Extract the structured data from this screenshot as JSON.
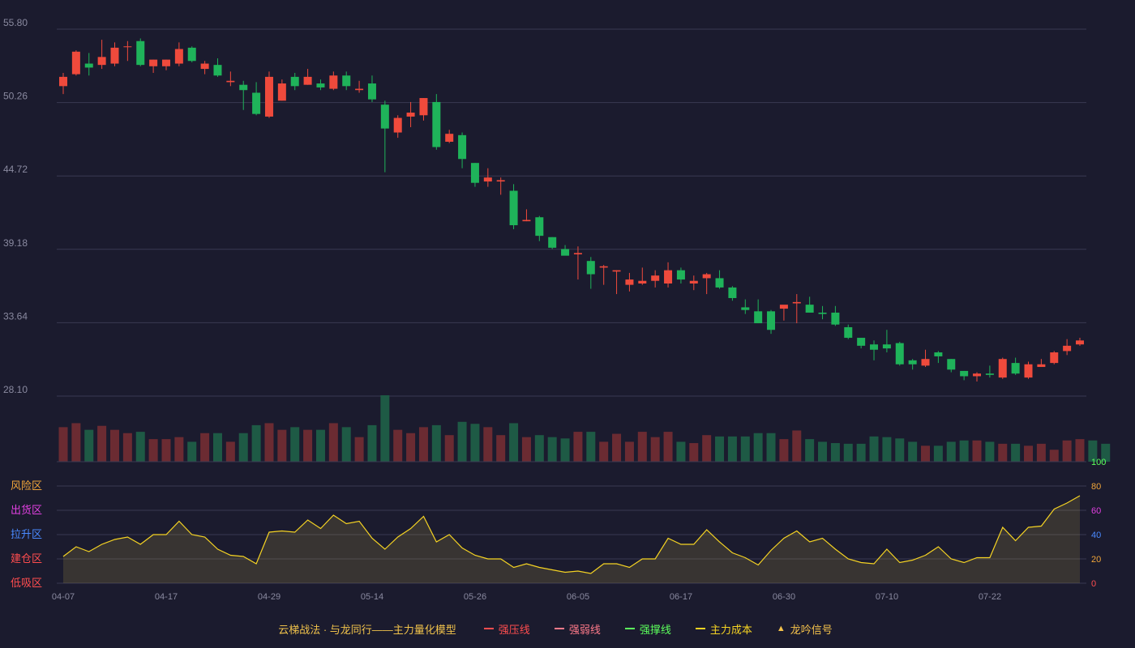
{
  "chart_data": {
    "type": "candlestick",
    "x_ticks": [
      "04-07",
      "04-17",
      "04-29",
      "05-14",
      "05-26",
      "06-05",
      "06-17",
      "06-30",
      "07-10",
      "07-22"
    ],
    "price_axis": {
      "ticks": [
        "55.80",
        "50.26",
        "44.72",
        "39.18",
        "33.64",
        "28.10"
      ],
      "ylim": [
        28.1,
        55.8
      ]
    },
    "candles": [
      {
        "o": 51.5,
        "h": 52.5,
        "l": 50.9,
        "c": 52.2
      },
      {
        "o": 52.4,
        "h": 54.2,
        "l": 52.3,
        "c": 54.1
      },
      {
        "o": 53.2,
        "h": 54.0,
        "l": 52.3,
        "c": 52.9
      },
      {
        "o": 53.1,
        "h": 55.0,
        "l": 52.8,
        "c": 53.7
      },
      {
        "o": 53.2,
        "h": 54.8,
        "l": 53.0,
        "c": 54.4
      },
      {
        "o": 54.5,
        "h": 54.9,
        "l": 53.4,
        "c": 54.5
      },
      {
        "o": 54.9,
        "h": 55.1,
        "l": 53.0,
        "c": 53.1
      },
      {
        "o": 53.0,
        "h": 53.5,
        "l": 52.5,
        "c": 53.5
      },
      {
        "o": 53.0,
        "h": 53.5,
        "l": 52.7,
        "c": 53.5
      },
      {
        "o": 53.2,
        "h": 54.8,
        "l": 53.0,
        "c": 54.3
      },
      {
        "o": 54.4,
        "h": 54.5,
        "l": 53.3,
        "c": 53.4
      },
      {
        "o": 52.8,
        "h": 53.4,
        "l": 52.4,
        "c": 53.2
      },
      {
        "o": 53.1,
        "h": 53.6,
        "l": 52.2,
        "c": 52.3
      },
      {
        "o": 51.8,
        "h": 52.6,
        "l": 51.5,
        "c": 51.9
      },
      {
        "o": 51.6,
        "h": 51.9,
        "l": 49.7,
        "c": 51.2
      },
      {
        "o": 51.0,
        "h": 51.8,
        "l": 49.3,
        "c": 49.4
      },
      {
        "o": 49.2,
        "h": 52.6,
        "l": 49.1,
        "c": 52.2
      },
      {
        "o": 50.4,
        "h": 52.0,
        "l": 50.4,
        "c": 51.7
      },
      {
        "o": 52.2,
        "h": 52.5,
        "l": 51.2,
        "c": 51.5
      },
      {
        "o": 51.6,
        "h": 52.8,
        "l": 51.6,
        "c": 52.2
      },
      {
        "o": 51.7,
        "h": 52.0,
        "l": 51.2,
        "c": 51.4
      },
      {
        "o": 51.3,
        "h": 52.6,
        "l": 51.2,
        "c": 52.3
      },
      {
        "o": 52.3,
        "h": 52.6,
        "l": 51.2,
        "c": 51.5
      },
      {
        "o": 51.2,
        "h": 51.9,
        "l": 51.0,
        "c": 51.3
      },
      {
        "o": 51.7,
        "h": 52.3,
        "l": 50.3,
        "c": 50.5
      },
      {
        "o": 50.1,
        "h": 50.4,
        "l": 45.0,
        "c": 48.3
      },
      {
        "o": 48.0,
        "h": 49.3,
        "l": 47.6,
        "c": 49.1
      },
      {
        "o": 49.2,
        "h": 50.3,
        "l": 48.4,
        "c": 49.5
      },
      {
        "o": 49.3,
        "h": 50.6,
        "l": 48.9,
        "c": 50.6
      },
      {
        "o": 50.3,
        "h": 50.9,
        "l": 46.7,
        "c": 46.9
      },
      {
        "o": 47.3,
        "h": 48.2,
        "l": 47.2,
        "c": 47.9
      },
      {
        "o": 47.8,
        "h": 48.0,
        "l": 45.3,
        "c": 46.0
      },
      {
        "o": 45.7,
        "h": 45.7,
        "l": 43.9,
        "c": 44.2
      },
      {
        "o": 44.3,
        "h": 45.3,
        "l": 43.9,
        "c": 44.6
      },
      {
        "o": 44.3,
        "h": 44.6,
        "l": 43.3,
        "c": 44.4
      },
      {
        "o": 43.6,
        "h": 44.1,
        "l": 40.7,
        "c": 41.0
      },
      {
        "o": 41.3,
        "h": 42.2,
        "l": 41.3,
        "c": 41.4
      },
      {
        "o": 41.6,
        "h": 41.7,
        "l": 39.8,
        "c": 40.2
      },
      {
        "o": 40.1,
        "h": 40.1,
        "l": 39.2,
        "c": 39.3
      },
      {
        "o": 39.2,
        "h": 39.5,
        "l": 38.8,
        "c": 38.7
      },
      {
        "o": 38.8,
        "h": 39.4,
        "l": 36.9,
        "c": 38.9
      },
      {
        "o": 38.3,
        "h": 38.6,
        "l": 36.2,
        "c": 37.3
      },
      {
        "o": 37.8,
        "h": 38.0,
        "l": 36.5,
        "c": 37.9
      },
      {
        "o": 37.5,
        "h": 37.6,
        "l": 35.8,
        "c": 37.6
      },
      {
        "o": 36.5,
        "h": 37.4,
        "l": 36.0,
        "c": 36.9
      },
      {
        "o": 36.6,
        "h": 37.8,
        "l": 36.5,
        "c": 36.8
      },
      {
        "o": 36.8,
        "h": 37.6,
        "l": 36.3,
        "c": 37.2
      },
      {
        "o": 36.6,
        "h": 38.2,
        "l": 36.3,
        "c": 37.6
      },
      {
        "o": 37.6,
        "h": 37.8,
        "l": 36.6,
        "c": 36.9
      },
      {
        "o": 36.6,
        "h": 37.2,
        "l": 36.1,
        "c": 36.8
      },
      {
        "o": 37.0,
        "h": 37.4,
        "l": 35.8,
        "c": 37.3
      },
      {
        "o": 37.0,
        "h": 37.6,
        "l": 36.2,
        "c": 36.3
      },
      {
        "o": 36.3,
        "h": 36.4,
        "l": 35.3,
        "c": 35.5
      },
      {
        "o": 34.8,
        "h": 35.4,
        "l": 34.3,
        "c": 34.6
      },
      {
        "o": 34.5,
        "h": 35.4,
        "l": 33.6,
        "c": 33.6
      },
      {
        "o": 34.5,
        "h": 34.6,
        "l": 32.8,
        "c": 33.1
      },
      {
        "o": 34.7,
        "h": 34.8,
        "l": 33.8,
        "c": 35.0
      },
      {
        "o": 35.1,
        "h": 35.8,
        "l": 33.6,
        "c": 35.2
      },
      {
        "o": 35.0,
        "h": 35.6,
        "l": 34.4,
        "c": 34.4
      },
      {
        "o": 34.4,
        "h": 34.9,
        "l": 33.9,
        "c": 34.3
      },
      {
        "o": 34.4,
        "h": 34.9,
        "l": 33.4,
        "c": 33.5
      },
      {
        "o": 33.3,
        "h": 33.5,
        "l": 32.4,
        "c": 32.5
      },
      {
        "o": 32.5,
        "h": 32.5,
        "l": 31.7,
        "c": 31.9
      },
      {
        "o": 32.0,
        "h": 32.3,
        "l": 30.8,
        "c": 31.6
      },
      {
        "o": 32.0,
        "h": 33.1,
        "l": 31.4,
        "c": 31.7
      },
      {
        "o": 32.1,
        "h": 32.2,
        "l": 30.4,
        "c": 30.5
      },
      {
        "o": 30.8,
        "h": 30.9,
        "l": 30.1,
        "c": 30.5
      },
      {
        "o": 30.4,
        "h": 31.6,
        "l": 30.3,
        "c": 30.9
      },
      {
        "o": 31.4,
        "h": 31.5,
        "l": 30.6,
        "c": 31.1
      },
      {
        "o": 30.9,
        "h": 30.9,
        "l": 29.9,
        "c": 30.1
      },
      {
        "o": 30.0,
        "h": 30.0,
        "l": 29.3,
        "c": 29.6
      },
      {
        "o": 29.6,
        "h": 29.9,
        "l": 29.2,
        "c": 29.8
      },
      {
        "o": 29.8,
        "h": 30.4,
        "l": 29.5,
        "c": 29.7
      },
      {
        "o": 29.5,
        "h": 31.0,
        "l": 29.4,
        "c": 30.9
      },
      {
        "o": 30.6,
        "h": 31.0,
        "l": 29.7,
        "c": 29.8
      },
      {
        "o": 29.5,
        "h": 30.7,
        "l": 29.4,
        "c": 30.5
      },
      {
        "o": 30.3,
        "h": 30.9,
        "l": 30.3,
        "c": 30.5
      },
      {
        "o": 30.6,
        "h": 31.5,
        "l": 30.5,
        "c": 31.4
      },
      {
        "o": 31.5,
        "h": 32.4,
        "l": 31.2,
        "c": 31.9
      },
      {
        "o": 32.0,
        "h": 32.5,
        "l": 31.9,
        "c": 32.3
      }
    ],
    "volumes": [
      52,
      58,
      48,
      54,
      48,
      43,
      45,
      34,
      34,
      37,
      30,
      43,
      43,
      30,
      43,
      55,
      58,
      48,
      52,
      48,
      48,
      58,
      52,
      37,
      55,
      100,
      48,
      43,
      52,
      55,
      40,
      60,
      57,
      52,
      40,
      58,
      37,
      40,
      37,
      35,
      45,
      45,
      30,
      42,
      30,
      45,
      37,
      45,
      30,
      28,
      40,
      38,
      38,
      38,
      43,
      43,
      34,
      47,
      34,
      30,
      28,
      27,
      27,
      38,
      37,
      35,
      30,
      24,
      24,
      30,
      32,
      32,
      30,
      27,
      27,
      24,
      27,
      18,
      32,
      34,
      32,
      27
    ],
    "indicator_axis": {
      "ticks": [
        "100",
        "80",
        "60",
        "40",
        "20",
        "0"
      ],
      "ylim": [
        0,
        100
      ]
    },
    "zones": [
      "风险区",
      "出货区",
      "拉升区",
      "建仓区",
      "低吸区"
    ],
    "indicator": [
      22,
      30,
      26,
      32,
      36,
      38,
      32,
      40,
      40,
      51,
      40,
      38,
      28,
      23,
      22,
      16,
      42,
      43,
      42,
      52,
      45,
      56,
      49,
      51,
      37,
      28,
      38,
      45,
      55,
      34,
      40,
      29,
      23,
      20,
      20,
      13,
      16,
      13,
      11,
      9,
      10,
      8,
      16,
      16,
      13,
      20,
      20,
      37,
      32,
      32,
      44,
      34,
      25,
      21,
      15,
      27,
      37,
      43,
      34,
      37,
      28,
      20,
      17,
      16,
      28,
      17,
      19,
      23,
      30,
      20,
      17,
      21,
      21,
      46,
      35,
      46,
      47,
      61,
      66,
      72
    ]
  },
  "legend": {
    "title": "云梯战法 · 与龙同行——主力量化模型",
    "items": [
      {
        "label": "强压线",
        "color": "#ff4d4f",
        "style": "solid"
      },
      {
        "label": "强弱线",
        "color": "#ff7a8a",
        "style": "dash"
      },
      {
        "label": "强撑线",
        "color": "#5cff5c",
        "style": "solid"
      },
      {
        "label": "主力成本",
        "color": "#f5d323",
        "style": "dash"
      },
      {
        "label": "龙吟信号",
        "color": "#f5c24b",
        "style": "triangle"
      }
    ]
  },
  "colors": {
    "background": "#1b1b2e",
    "up": "#ef4a3c",
    "down": "#1fb35a",
    "vol_up": "#6b2b32",
    "vol_down": "#1e5a45",
    "indicator_line": "#f5d323",
    "zone_colors": [
      "#f0a53a",
      "#e040e0",
      "#4a8aff",
      "#ff4d4f",
      "#ff4d4f"
    ],
    "indicator_tick_colors": [
      "#5cff5c",
      "#f0a53a",
      "#e040e0",
      "#4a8aff",
      "#f0a53a",
      "#ff4d4f"
    ]
  }
}
